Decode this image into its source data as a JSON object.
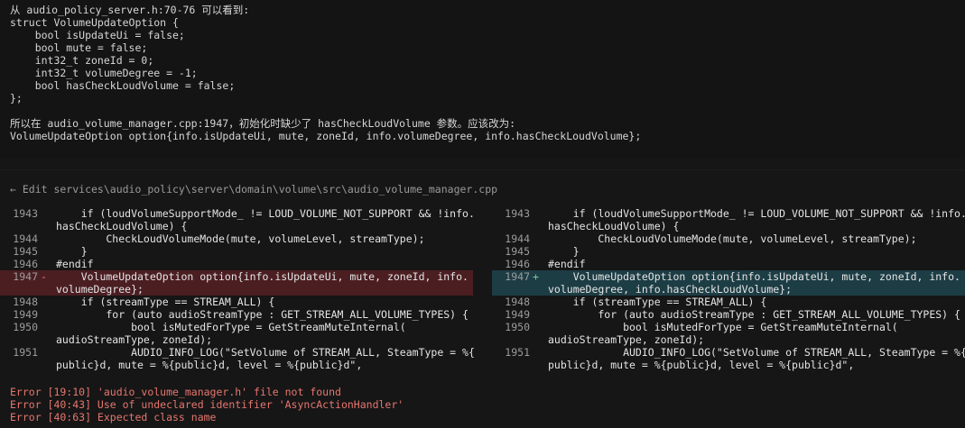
{
  "intro": {
    "source_line": "从 audio_policy_server.h:70-76 可以看到:",
    "struct_lines": [
      "struct VolumeUpdateOption {",
      "    bool isUpdateUi = false;",
      "    bool mute = false;",
      "    int32_t zoneId = 0;",
      "    int32_t volumeDegree = -1;",
      "    bool hasCheckLoudVolume = false;",
      "};"
    ],
    "conclusion_line": "所以在 audio_volume_manager.cpp:1947，初始化时缺少了 hasCheckLoudVolume 参数。应该改为:",
    "fix_line": "VolumeUpdateOption option{info.isUpdateUi, mute, zoneId, info.volumeDegree, info.hasCheckLoudVolume};"
  },
  "edit": {
    "label": "← Edit services\\audio_policy\\server\\domain\\volume\\src\\audio_volume_manager.cpp"
  },
  "diff": {
    "left": [
      {
        "num": "1943",
        "sign": "",
        "text": "    if (loudVolumeSupportMode_ != LOUD_VOLUME_NOT_SUPPORT && !info.",
        "kind": "ctx"
      },
      {
        "num": "",
        "sign": "",
        "text": "hasCheckLoudVolume) {",
        "kind": "ctx"
      },
      {
        "num": "1944",
        "sign": "",
        "text": "        CheckLoudVolumeMode(mute, volumeLevel, streamType);",
        "kind": "ctx"
      },
      {
        "num": "1945",
        "sign": "",
        "text": "    }",
        "kind": "ctx"
      },
      {
        "num": "1946",
        "sign": "",
        "text": "#endif",
        "kind": "ctx"
      },
      {
        "num": "1947",
        "sign": "-",
        "text": "    VolumeUpdateOption option{info.isUpdateUi, mute, zoneId, info.",
        "kind": "del"
      },
      {
        "num": "",
        "sign": "",
        "text": "volumeDegree};",
        "kind": "del"
      },
      {
        "num": "1948",
        "sign": "",
        "text": "    if (streamType == STREAM_ALL) {",
        "kind": "ctx"
      },
      {
        "num": "1949",
        "sign": "",
        "text": "        for (auto audioStreamType : GET_STREAM_ALL_VOLUME_TYPES) {",
        "kind": "ctx"
      },
      {
        "num": "1950",
        "sign": "",
        "text": "            bool isMutedForType = GetStreamMuteInternal(",
        "kind": "ctx"
      },
      {
        "num": "",
        "sign": "",
        "text": "audioStreamType, zoneId);",
        "kind": "ctx"
      },
      {
        "num": "1951",
        "sign": "",
        "text": "            AUDIO_INFO_LOG(\"SetVolume of STREAM_ALL, SteamType = %{",
        "kind": "ctx"
      },
      {
        "num": "",
        "sign": "",
        "text": "public}d, mute = %{public}d, level = %{public}d\",",
        "kind": "ctx"
      }
    ],
    "right": [
      {
        "num": "1943",
        "sign": "",
        "text": "    if (loudVolumeSupportMode_ != LOUD_VOLUME_NOT_SUPPORT && !info.",
        "kind": "ctx"
      },
      {
        "num": "",
        "sign": "",
        "text": "hasCheckLoudVolume) {",
        "kind": "ctx"
      },
      {
        "num": "1944",
        "sign": "",
        "text": "        CheckLoudVolumeMode(mute, volumeLevel, streamType);",
        "kind": "ctx"
      },
      {
        "num": "1945",
        "sign": "",
        "text": "    }",
        "kind": "ctx"
      },
      {
        "num": "1946",
        "sign": "",
        "text": "#endif",
        "kind": "ctx"
      },
      {
        "num": "1947",
        "sign": "+",
        "text": "    VolumeUpdateOption option{info.isUpdateUi, mute, zoneId, info.",
        "kind": "add"
      },
      {
        "num": "",
        "sign": "",
        "text": "volumeDegree, info.hasCheckLoudVolume};",
        "kind": "add"
      },
      {
        "num": "1948",
        "sign": "",
        "text": "    if (streamType == STREAM_ALL) {",
        "kind": "ctx"
      },
      {
        "num": "1949",
        "sign": "",
        "text": "        for (auto audioStreamType : GET_STREAM_ALL_VOLUME_TYPES) {",
        "kind": "ctx"
      },
      {
        "num": "1950",
        "sign": "",
        "text": "            bool isMutedForType = GetStreamMuteInternal(",
        "kind": "ctx"
      },
      {
        "num": "",
        "sign": "",
        "text": "audioStreamType, zoneId);",
        "kind": "ctx"
      },
      {
        "num": "1951",
        "sign": "",
        "text": "            AUDIO_INFO_LOG(\"SetVolume of STREAM_ALL, SteamType = %{",
        "kind": "ctx"
      },
      {
        "num": "",
        "sign": "",
        "text": "public}d, mute = %{public}d, level = %{public}d\",",
        "kind": "ctx"
      }
    ]
  },
  "errors": [
    "Error [19:10] 'audio_volume_manager.h' file not found",
    "Error [40:43] Use of undeclared identifier 'AsyncActionHandler'",
    "Error [40:63] Expected class name"
  ],
  "colors": {
    "background": "#161616",
    "deleted_line_bg": "#4b1e22",
    "added_line_bg": "#1d3d45",
    "error_text": "#e7766f",
    "member_highlight": "#d87bd0"
  }
}
